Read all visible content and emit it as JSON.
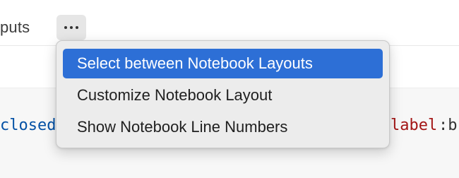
{
  "toolbar": {
    "partial_label": "puts",
    "more_button_icon": "ellipsis-icon"
  },
  "editor": {
    "code_left_fragment": "closed",
    "code_right_label": "label",
    "code_right_colon": ":b"
  },
  "context_menu": {
    "items": [
      {
        "label": "Select between Notebook Layouts",
        "selected": true
      },
      {
        "label": "Customize Notebook Layout",
        "selected": false
      },
      {
        "label": "Show Notebook Line Numbers",
        "selected": false
      }
    ]
  },
  "colors": {
    "selection_blue": "#2d6fd6",
    "menu_background": "#ececec",
    "code_keyword_blue": "#0451a5",
    "code_property_red": "#a31515"
  }
}
